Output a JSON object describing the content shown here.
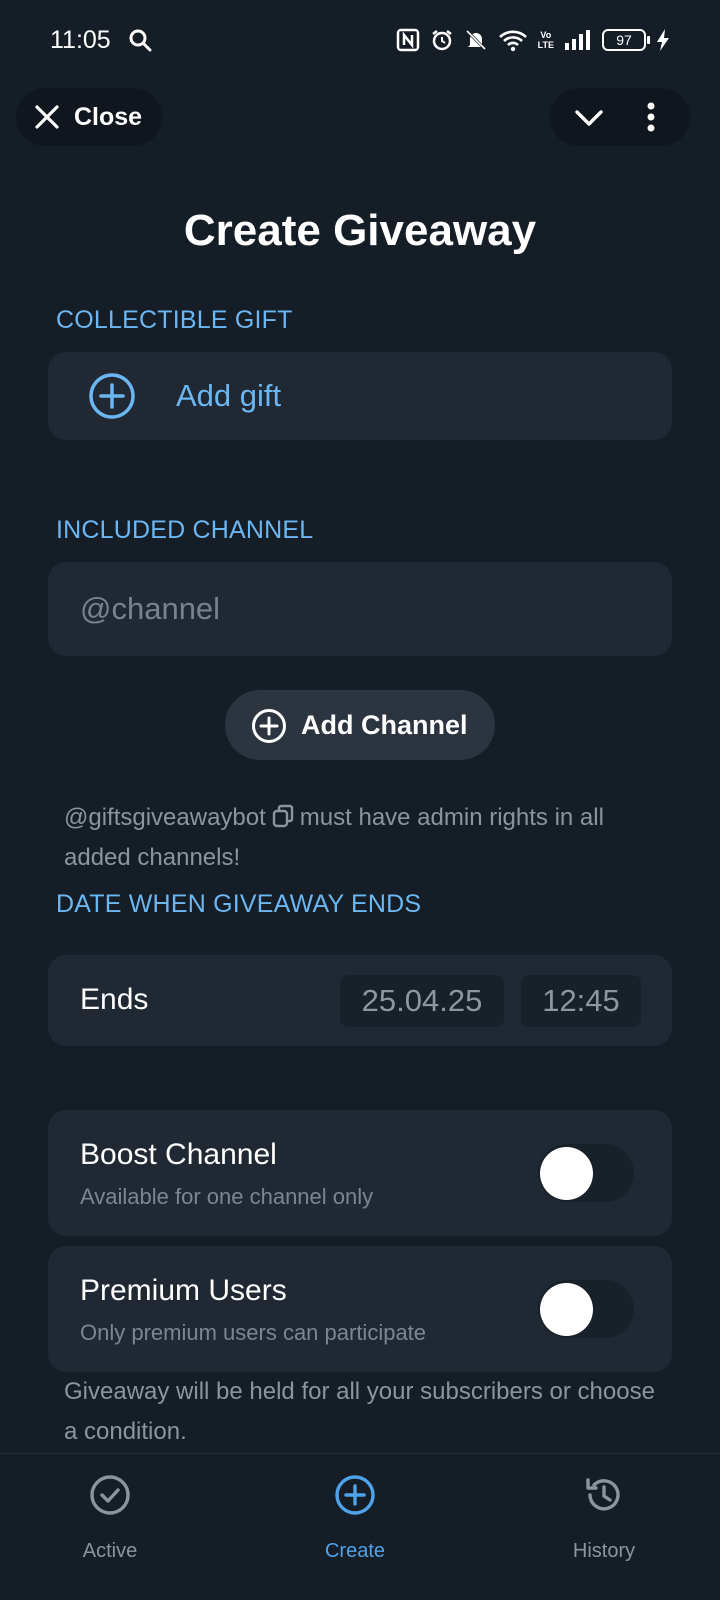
{
  "status_bar": {
    "time": "11:05",
    "battery": "97",
    "volte_top": "Vo",
    "volte_bottom": "LTE"
  },
  "header": {
    "close_label": "Close"
  },
  "page": {
    "title": "Create Giveaway"
  },
  "gift_section": {
    "label": "COLLECTIBLE GIFT",
    "add_label": "Add gift"
  },
  "channel_section": {
    "label": "INCLUDED CHANNEL",
    "input_placeholder": "@channel",
    "input_value": "",
    "add_button_label": "Add Channel",
    "note_handle": "@giftsgiveawaybot",
    "note_text": "must have admin rights in all added channels!"
  },
  "date_section": {
    "label": "DATE WHEN GIVEAWAY ENDS",
    "row_label": "Ends",
    "date": "25.04.25",
    "time": "12:45"
  },
  "options": [
    {
      "title": "Boost Channel",
      "subtitle": "Available for one channel only",
      "enabled": false
    },
    {
      "title": "Premium Users",
      "subtitle": "Only premium users can participate",
      "enabled": false
    }
  ],
  "footer_note": "Giveaway will be held for all your subscribers or choose a condition.",
  "bottom_nav": {
    "items": [
      {
        "label": "Active",
        "icon": "check-circle-icon",
        "active": false
      },
      {
        "label": "Create",
        "icon": "plus-circle-icon",
        "active": true
      },
      {
        "label": "History",
        "icon": "history-icon",
        "active": false
      }
    ]
  },
  "colors": {
    "background": "#151d26",
    "card": "#1f2833",
    "accent": "#6cb6f2",
    "muted_text": "#8c959e"
  }
}
